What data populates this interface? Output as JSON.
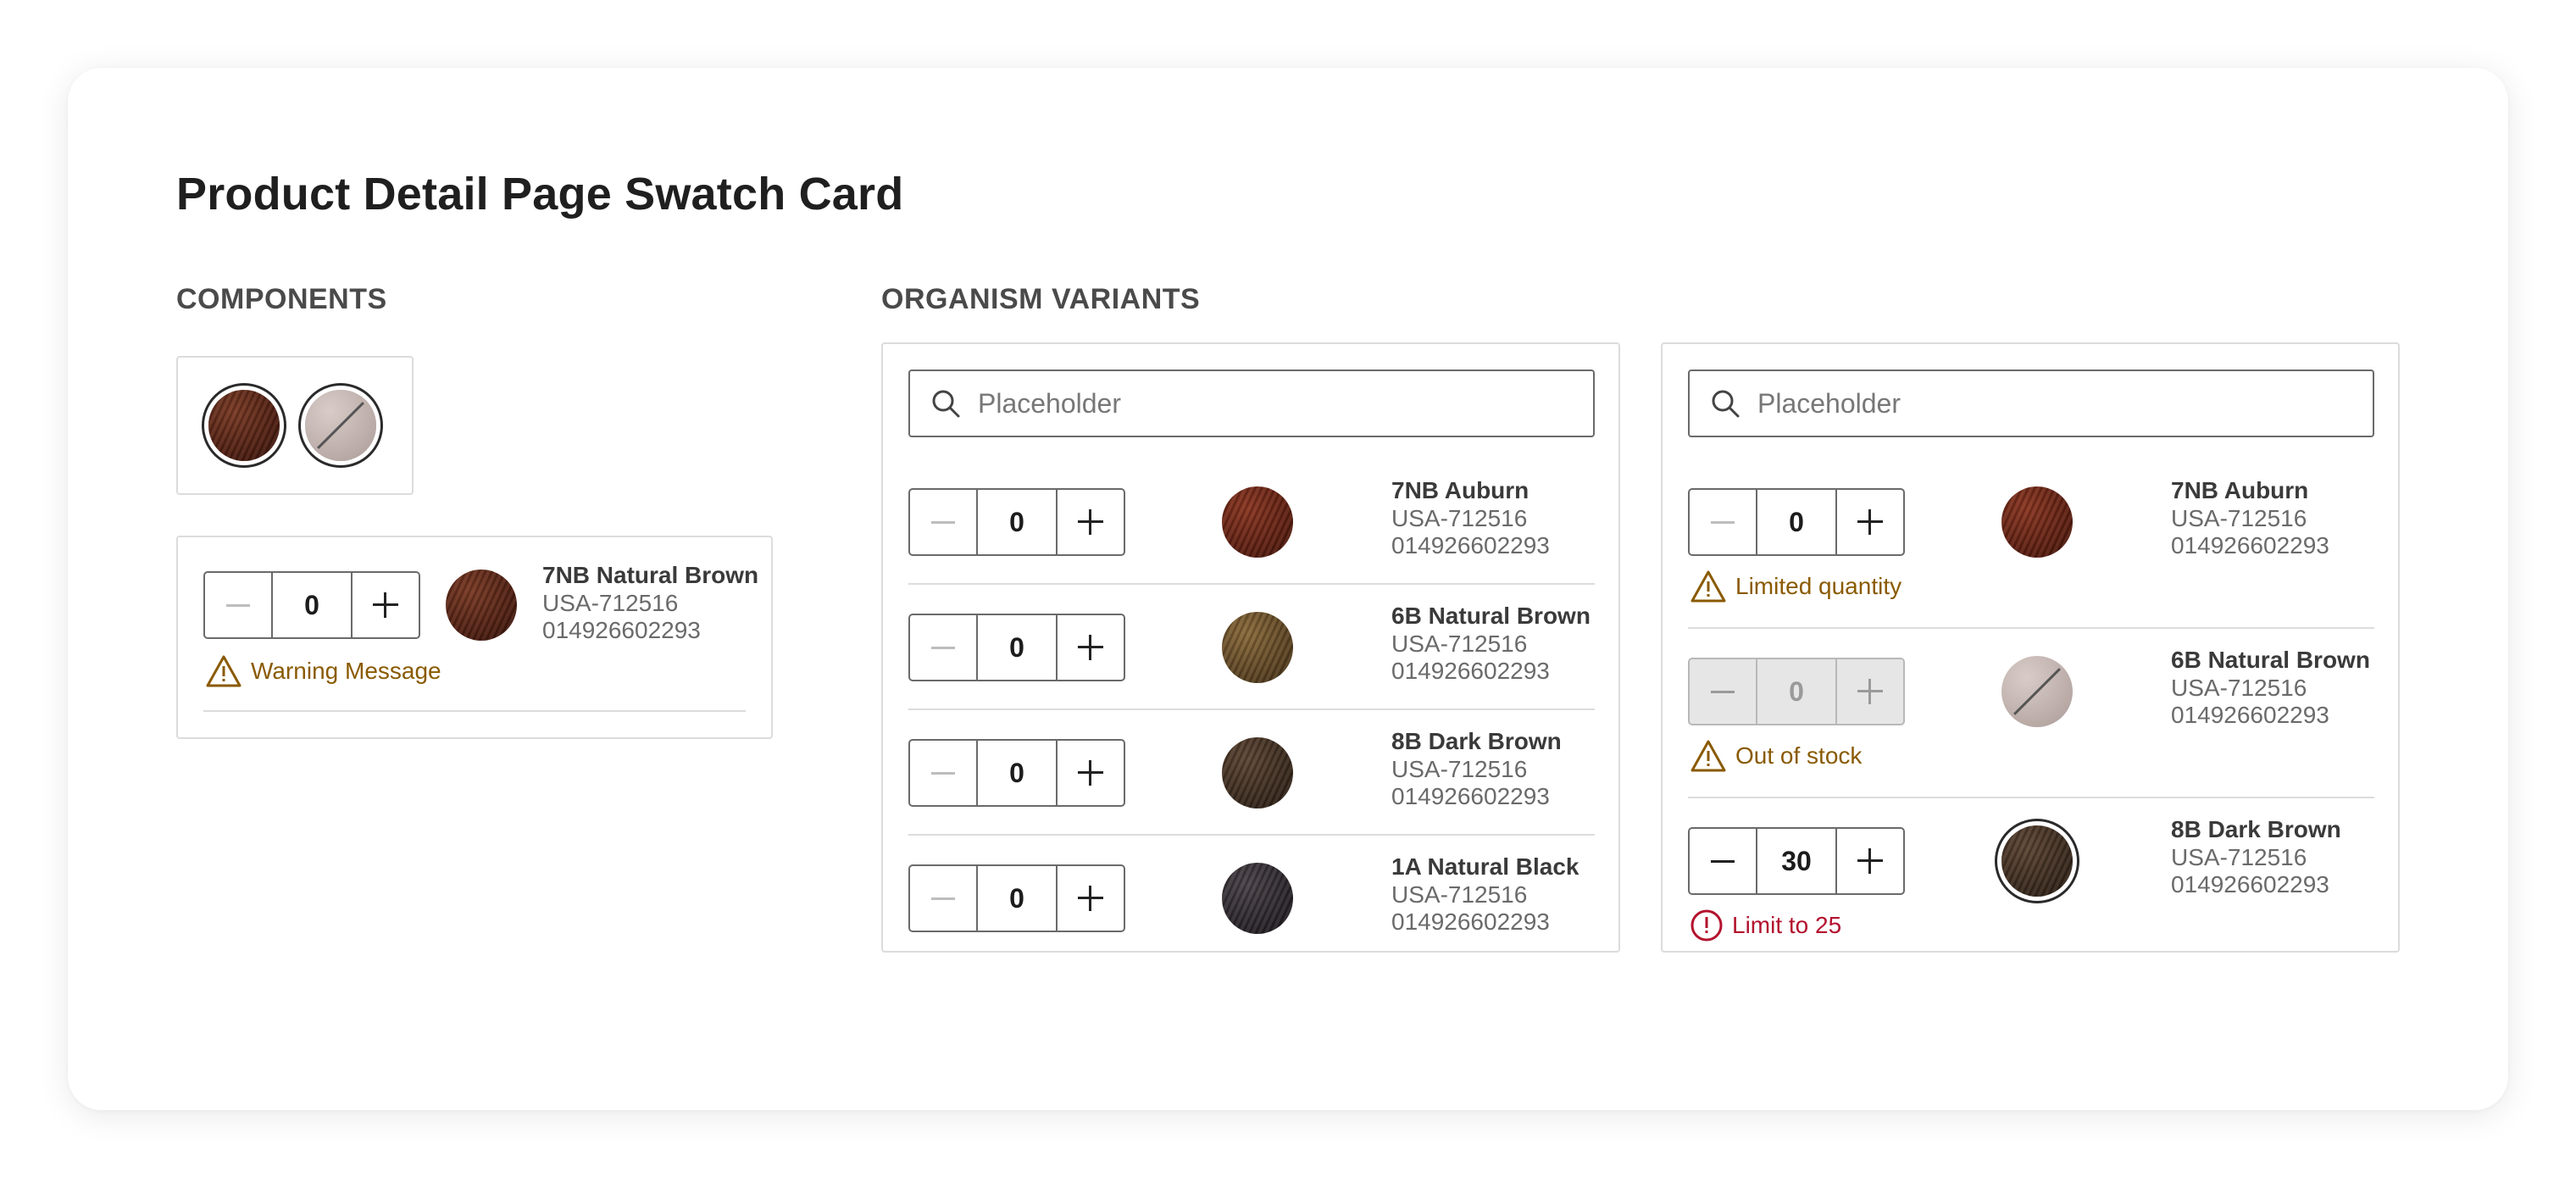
{
  "title": "Product Detail Page Swatch Card",
  "components": {
    "heading": "COMPONENTS",
    "card": {
      "qty": "0",
      "name": "7NB Natural Brown",
      "sku": "USA-712516",
      "upc": "014926602293",
      "message": "Warning Message"
    }
  },
  "organism": {
    "heading": "ORGANISM VARIANTS",
    "left": {
      "placeholder": "Placeholder",
      "rows": [
        {
          "qty": "0",
          "name": "7NB Auburn",
          "sku": "USA-712516",
          "upc": "014926602293"
        },
        {
          "qty": "0",
          "name": "6B Natural Brown",
          "sku": "USA-712516",
          "upc": "014926602293"
        },
        {
          "qty": "0",
          "name": "8B Dark Brown",
          "sku": "USA-712516",
          "upc": "014926602293"
        },
        {
          "qty": "0",
          "name": "1A Natural Black",
          "sku": "USA-712516",
          "upc": "014926602293"
        }
      ]
    },
    "right": {
      "placeholder": "Placeholder",
      "rows": [
        {
          "qty": "0",
          "name": "7NB Auburn",
          "sku": "USA-712516",
          "upc": "014926602293",
          "message": "Limited quantity"
        },
        {
          "qty": "0",
          "name": "6B Natural Brown",
          "sku": "USA-712516",
          "upc": "014926602293",
          "message": "Out of stock"
        },
        {
          "qty": "30",
          "name": "8B Dark Brown",
          "sku": "USA-712516",
          "upc": "014926602293",
          "message": "Limit to 25"
        }
      ]
    }
  },
  "colors": {
    "warning": "#8a5a00",
    "error": "#b3122e",
    "border": "#dcdcdc"
  }
}
